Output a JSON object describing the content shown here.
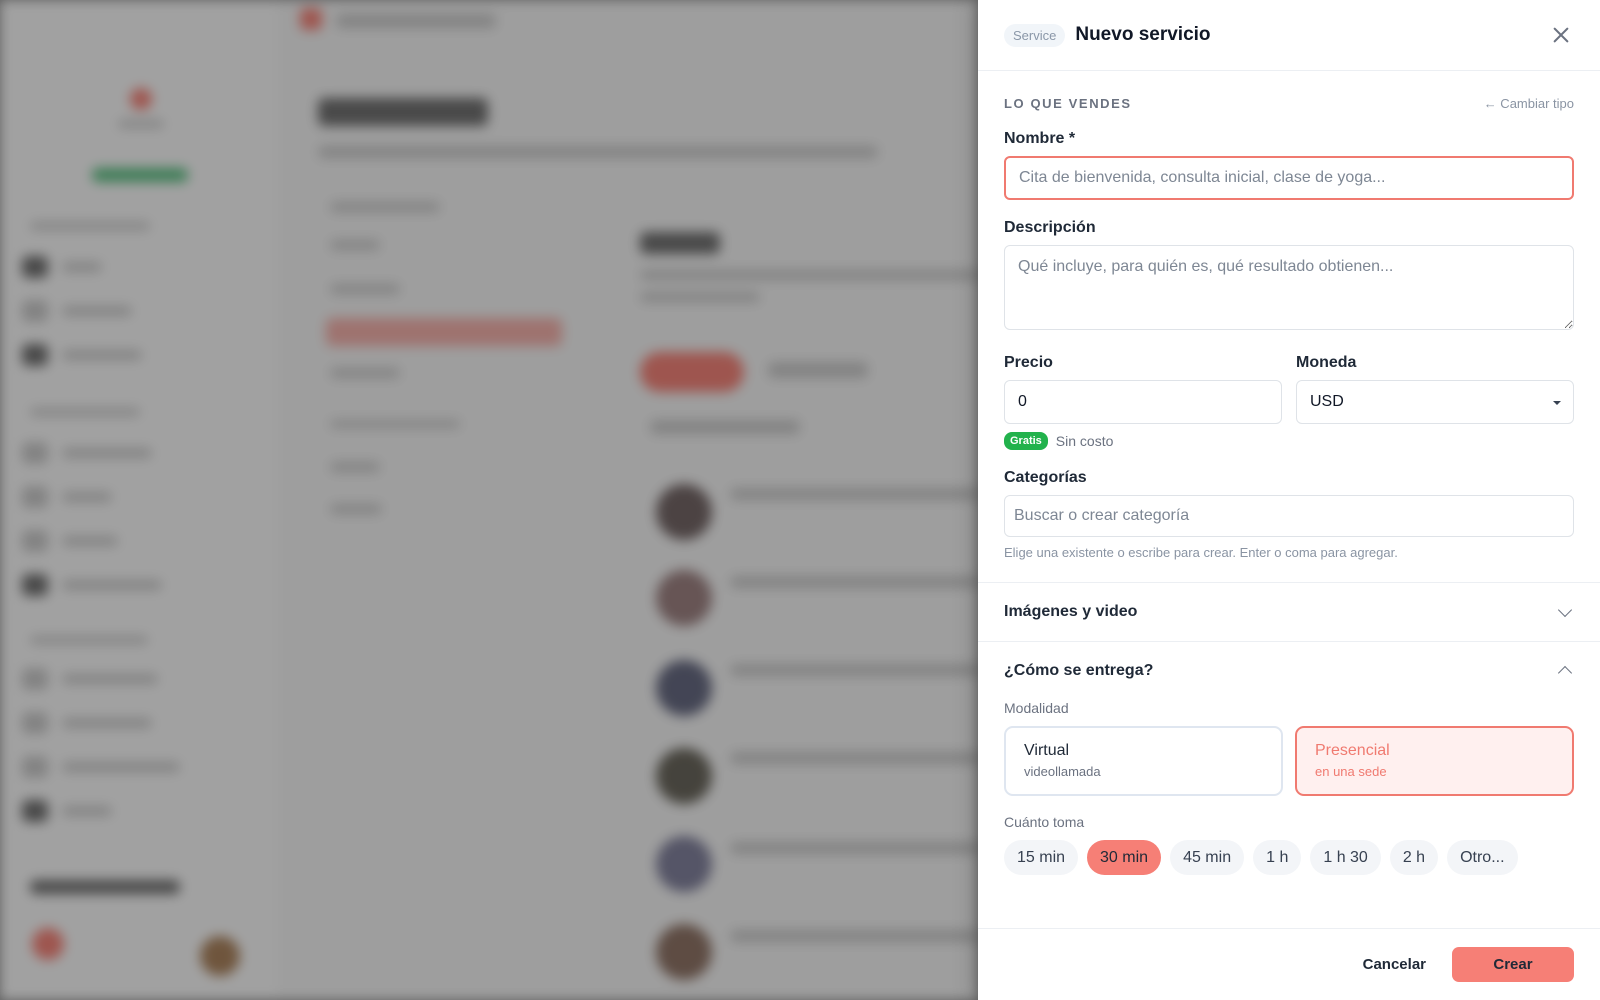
{
  "drawer": {
    "type_badge": "Service",
    "title": "Nuevo servicio",
    "section_label": "LO QUE VENDES",
    "change_type": "← Cambiar tipo",
    "name": {
      "label": "Nombre *",
      "value": "",
      "placeholder": "Cita de bienvenida, consulta inicial, clase de yoga..."
    },
    "description": {
      "label": "Descripción",
      "value": "",
      "placeholder": "Qué incluye, para quién es, qué resultado obtienen..."
    },
    "price": {
      "label": "Precio",
      "value": "0"
    },
    "currency": {
      "label": "Moneda",
      "selected": "USD"
    },
    "price_hint": {
      "badge": "Gratis",
      "text": "Sin costo"
    },
    "categories": {
      "label": "Categorías",
      "placeholder": "Buscar o crear categoría",
      "help": "Elige una existente o escribe para crear. Enter o coma para agregar."
    },
    "media_section": {
      "title": "Imágenes y video",
      "expanded": false
    },
    "delivery_section": {
      "title": "¿Cómo se entrega?",
      "expanded": true,
      "modality_label": "Modalidad",
      "modalities": [
        {
          "title": "Virtual",
          "subtitle": "videollamada",
          "selected": false
        },
        {
          "title": "Presencial",
          "subtitle": "en una sede",
          "selected": true
        }
      ],
      "duration_label": "Cuánto toma",
      "durations": [
        "15 min",
        "30 min",
        "45 min",
        "1 h",
        "1 h 30",
        "2 h",
        "Otro..."
      ],
      "selected_duration": "30 min"
    },
    "footer": {
      "cancel": "Cancelar",
      "create": "Crear"
    }
  },
  "colors": {
    "accent": "#f67f76",
    "accent_border": "#f07a70",
    "accent_bg": "#fff0ef",
    "success": "#22b24c"
  },
  "icons": [
    "close-icon",
    "chevron-down-icon",
    "chevron-up-icon",
    "caret-down-icon"
  ]
}
